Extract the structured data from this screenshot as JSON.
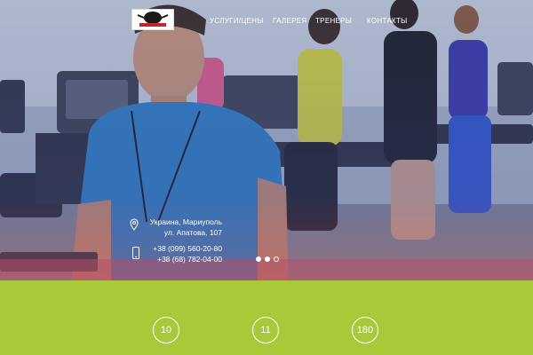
{
  "logo": {
    "text": "AtletikaFit"
  },
  "nav": {
    "items": [
      {
        "label": "УСЛУГИ/ЦЕНЫ"
      },
      {
        "label": "ГАЛЕРЕЯ"
      },
      {
        "label": "ТРЕНЕРЫ"
      },
      {
        "label": "КОНТАКТЫ"
      }
    ]
  },
  "contact": {
    "address_line1": "Украина, Мариуполь",
    "address_line2": "ул. Апатова, 107",
    "phone1": "+38 (099) 560-20-80",
    "phone2": "+38 (68) 782-04-00"
  },
  "slider": {
    "count": 3,
    "active_index": 1
  },
  "stats": [
    {
      "value": "10"
    },
    {
      "value": "11"
    },
    {
      "value": "180"
    }
  ],
  "colors": {
    "accent_green": "#a7c93a",
    "text_white": "#ffffff"
  },
  "icons": {
    "address": "map-pin-icon",
    "phone": "phone-icon"
  }
}
